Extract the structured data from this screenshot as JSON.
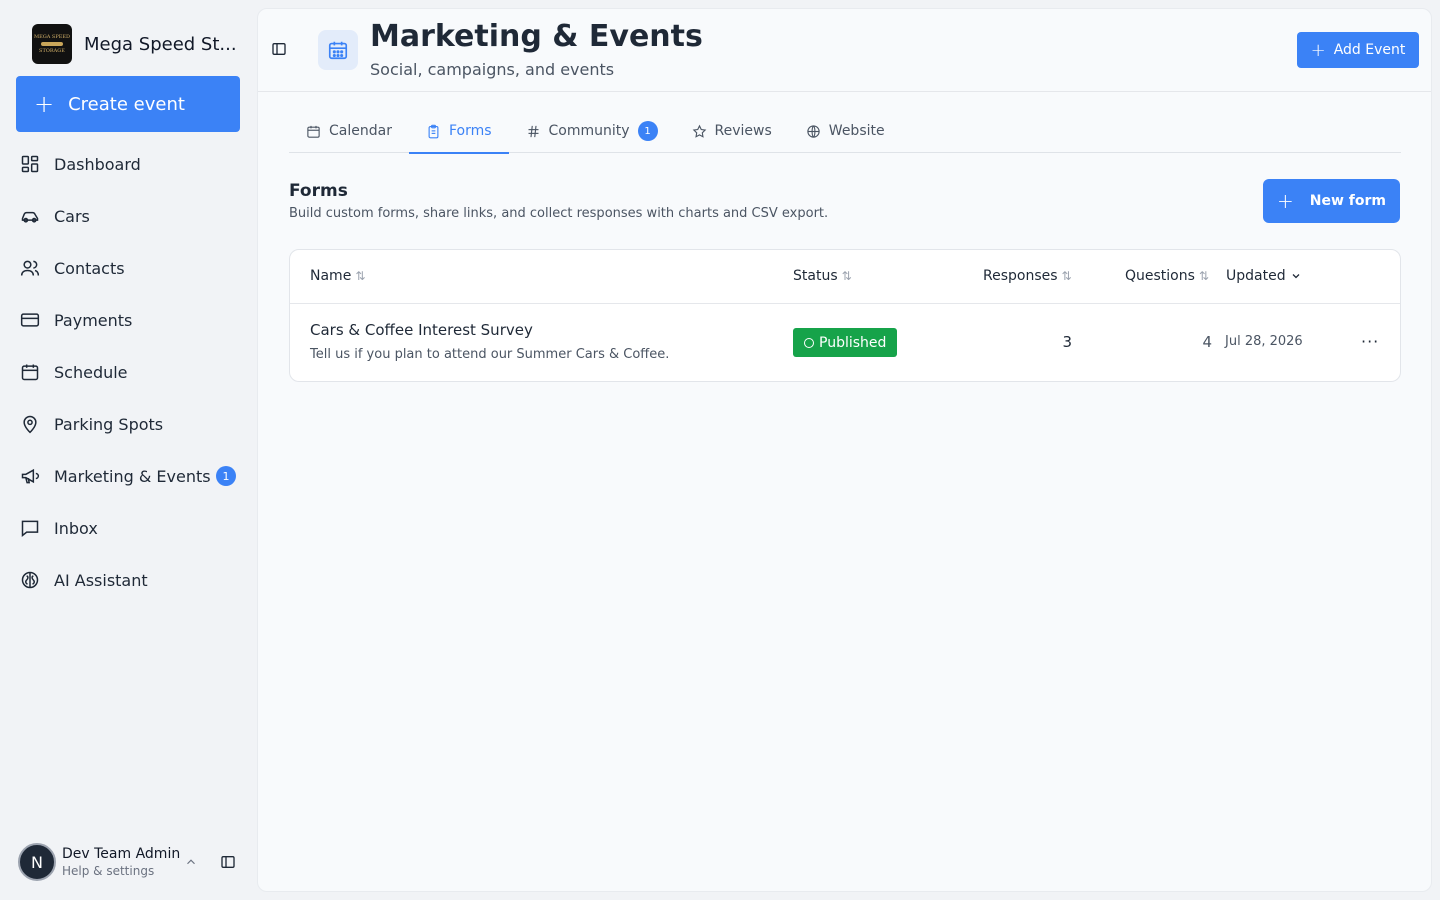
{
  "sidebar": {
    "brand_name": "Mega Speed St...",
    "logo_text_top": "MEGA SPEED",
    "logo_text_bottom": "STORAGE",
    "create_label": "Create event",
    "items": [
      {
        "label": "Dashboard",
        "icon": "dashboard-icon"
      },
      {
        "label": "Cars",
        "icon": "car-icon"
      },
      {
        "label": "Contacts",
        "icon": "users-icon"
      },
      {
        "label": "Payments",
        "icon": "credit-card-icon"
      },
      {
        "label": "Schedule",
        "icon": "calendar-icon"
      },
      {
        "label": "Parking Spots",
        "icon": "map-pin-icon"
      },
      {
        "label": "Marketing & Events",
        "icon": "megaphone-icon",
        "badge": "1"
      },
      {
        "label": "Inbox",
        "icon": "message-icon"
      },
      {
        "label": "AI Assistant",
        "icon": "brain-icon"
      }
    ],
    "user": {
      "initial": "N",
      "name": "Dev Team Admin",
      "sub": "Help & settings"
    }
  },
  "header": {
    "title": "Marketing & Events",
    "subtitle": "Social, campaigns, and events",
    "add_label": "Add Event"
  },
  "tabs": [
    {
      "label": "Calendar",
      "icon": "calendar-icon"
    },
    {
      "label": "Forms",
      "icon": "clipboard-icon",
      "active": true
    },
    {
      "label": "Community",
      "icon": "hash-icon",
      "badge": "1"
    },
    {
      "label": "Reviews",
      "icon": "star-icon"
    },
    {
      "label": "Website",
      "icon": "globe-icon"
    }
  ],
  "forms": {
    "title": "Forms",
    "description": "Build custom forms, share links, and collect responses with charts and CSV export.",
    "new_label": "New form",
    "columns": {
      "name": "Name",
      "status": "Status",
      "responses": "Responses",
      "questions": "Questions",
      "updated": "Updated"
    },
    "rows": [
      {
        "name": "Cars & Coffee Interest Survey",
        "description": "Tell us if you plan to attend our Summer Cars & Coffee.",
        "status": "Published",
        "responses": "3",
        "questions": "4",
        "updated": "Jul 28, 2026",
        "more": "···"
      }
    ]
  },
  "colors": {
    "accent": "#3b82f6",
    "published": "#16a34a"
  }
}
